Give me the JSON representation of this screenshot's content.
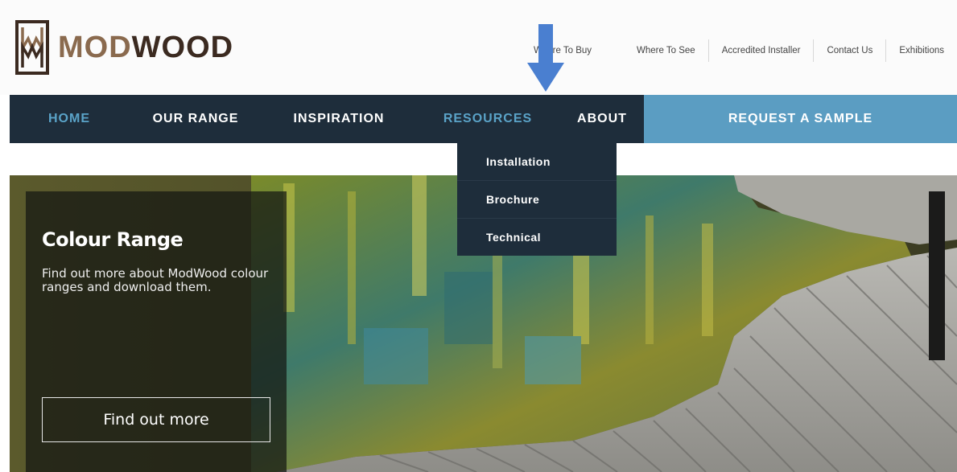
{
  "brand": {
    "name_part1": "MOD",
    "name_part2": "WOOD",
    "primary_color": "#8a6a4e",
    "dark_color": "#3b2a20"
  },
  "utility_nav": [
    {
      "label": "Where To Buy"
    },
    {
      "label": "Where To See"
    },
    {
      "label": "Accredited Installer"
    },
    {
      "label": "Contact Us"
    },
    {
      "label": "Exhibitions"
    }
  ],
  "main_nav": {
    "items": [
      {
        "label": "HOME",
        "active": true
      },
      {
        "label": "OUR RANGE"
      },
      {
        "label": "INSPIRATION"
      },
      {
        "label": "RESOURCES",
        "open": true
      },
      {
        "label": "ABOUT"
      }
    ],
    "cta_label": "REQUEST A SAMPLE",
    "bg_color": "#1e2d3b",
    "active_color": "#5aa3c8",
    "cta_color": "#5b9dc2"
  },
  "resources_dropdown": [
    {
      "label": "Installation"
    },
    {
      "label": "Brochure"
    },
    {
      "label": "Technical"
    }
  ],
  "annotation": {
    "icon": "down-arrow-icon",
    "color": "#4a7fd0"
  },
  "hero": {
    "title": "Colour Range",
    "description": "Find out more about ModWood colour ranges and download them.",
    "button_label": "Find out more"
  }
}
